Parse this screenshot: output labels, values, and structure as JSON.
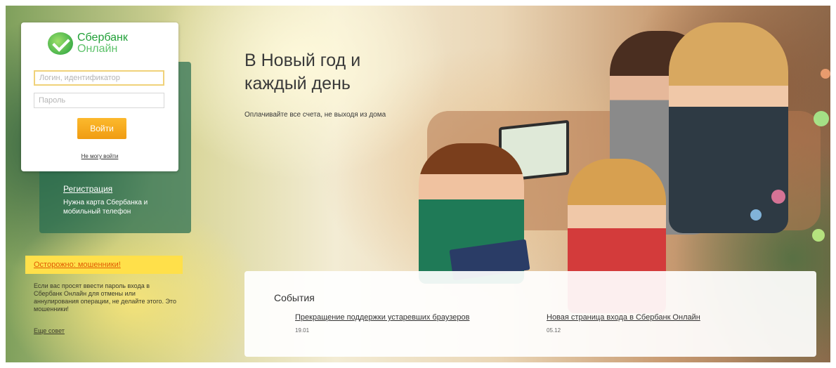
{
  "login": {
    "logo_line1": "Сбербанк",
    "logo_line2": "Онлайн",
    "login_placeholder": "Логин, идентификатор",
    "password_placeholder": "Пароль",
    "submit_label": "Войти",
    "cant_login_label": "Не могу войти"
  },
  "registration": {
    "link_label": "Регистрация",
    "note": "Нужна карта Сбербанка и мобильный телефон"
  },
  "fraud": {
    "title": "Осторожно: мошенники!",
    "text": "Если вас просят ввести пароль входа в Сбербанк Онлайн для отмены или аннулирования операции, не делайте этого. Это мошенники!",
    "more_label": "Еще совет"
  },
  "hero": {
    "title_line1": "В Новый год и",
    "title_line2": "каждый день",
    "subtitle": "Оплачивайте все счета, не выходя из дома"
  },
  "events": {
    "title": "События",
    "items": [
      {
        "title": "Прекращение поддержки устаревших браузеров",
        "date": "19.01"
      },
      {
        "title": "Новая страница входа в Сбербанк Онлайн",
        "date": "05.12"
      }
    ]
  },
  "colors": {
    "brand_green": "#21a038",
    "login_button": "#f5a623",
    "warning_bg": "#ffe04a"
  }
}
